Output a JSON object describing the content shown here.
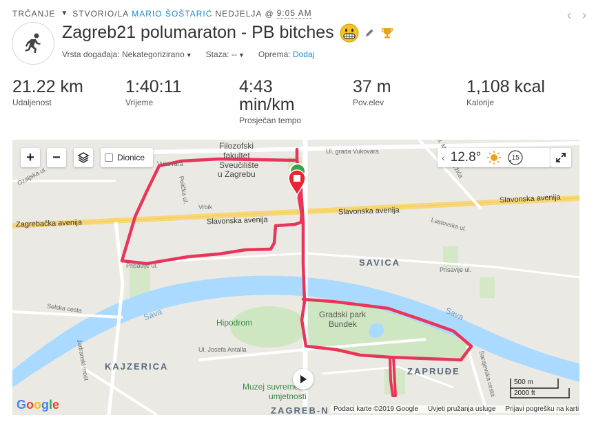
{
  "header": {
    "activity_type": "TRČANJE",
    "created_by": "STVORIO/LA",
    "author": "MARIO ŠOŠTARIĆ",
    "day": "NEDJELJA",
    "at": "@",
    "time": "9:05 AM",
    "title": "Zagreb21 polumaraton - PB bitches",
    "icons": [
      "running-icon",
      "grinning-emoji-icon",
      "pencil-icon",
      "trophy-icon"
    ]
  },
  "meta": {
    "event_label": "Vrsta događaja:",
    "event_value": "Nekategorizirano",
    "route_label": "Staza:",
    "route_value": "--",
    "gear_label": "Oprema:",
    "gear_link": "Dodaj"
  },
  "stats": [
    {
      "value": "21.22 km",
      "label": "Udaljenost"
    },
    {
      "value": "1:40:11",
      "label": "Vrijeme"
    },
    {
      "value": "4:43",
      "value2": "min/km",
      "label": "Prosječan tempo"
    },
    {
      "value": "37 m",
      "label": "Pov.elev"
    },
    {
      "value": "1,108 kcal",
      "label": "Kalorije"
    }
  ],
  "map": {
    "zoom_in": "+",
    "zoom_out": "−",
    "dionice_label": "Dionice",
    "temperature": "12.8°",
    "wind": "15",
    "labels": {
      "filozofski": "Filozofski",
      "fakultet": "fakultet",
      "sveuciliste": "Sveučilište",
      "uzagrebu": "u Zagrebu",
      "vukovara_left": "Vukovara",
      "vukovara_right": "Ul. grada Vukovara",
      "ozaljska": "Ozaljska ul.",
      "politicka": "Polička ul.",
      "vrbik": "Vrbik",
      "slavonska1": "Slavonska avenija",
      "slavonska2": "Slavonska avenija",
      "zagrebacka": "Zagrebačka avenija",
      "savica": "SAVICA",
      "prisavlje_left": "Prisavlje ul.",
      "prisavlje_right": "Prisavlje ul.",
      "lastovska": "Lastovska ul.",
      "sava1": "Sava",
      "sava2": "Sava",
      "selska": "Selska cesta",
      "hipodrom": "Hipodrom",
      "bundek1": "Gradski park",
      "bundek2": "Bundek",
      "kajzerica": "KAJZERICA",
      "jadranski": "Jadranski most",
      "josipa": "Ul. Josefa Antalla",
      "muzej1": "Muzej suvremene",
      "muzej2": "umjetnosti",
      "zapruđe": "ZAPRUĐE",
      "sarajevska": "Sarajevska cesta",
      "zagrebn": "ZAGREB-N",
      "marina": "Ul. Marina Držića"
    },
    "google": "Google",
    "scale_m": "500 m",
    "scale_ft": "2000 ft",
    "footer": [
      "Podaci karte ©2019 Google",
      "Uvjeti pružanja usluge",
      "Prijavi pogrešku na karti"
    ],
    "route_color": "#e8355a"
  }
}
